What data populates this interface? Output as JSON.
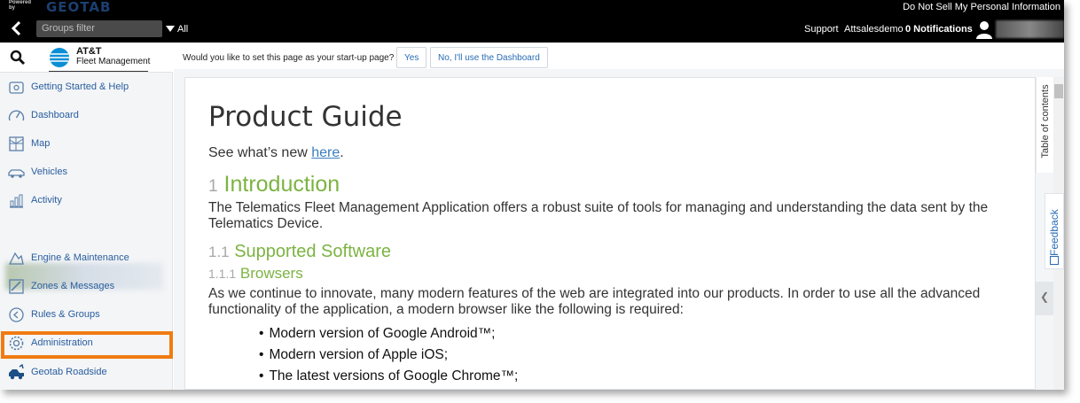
{
  "topbar": {
    "powered_by": "Powered by",
    "brand": "GEOTAB",
    "do_not_sell": "Do Not Sell My Personal Information"
  },
  "navbar": {
    "groups_placeholder": "Groups filter",
    "all_label": "All",
    "support": "Support",
    "user": "Attsalesdemo",
    "notifications": "0 Notifications"
  },
  "sidebar": {
    "logo_name": "AT&T",
    "logo_sub": "Fleet Management",
    "items": [
      {
        "label": "Getting Started & Help",
        "icon": "help-icon"
      },
      {
        "label": "Dashboard",
        "icon": "gauge-icon"
      },
      {
        "label": "Map",
        "icon": "map-icon"
      },
      {
        "label": "Vehicles",
        "icon": "vehicle-icon"
      },
      {
        "label": "Activity",
        "icon": "activity-icon"
      },
      {
        "label": "Engine & Maintenance",
        "icon": "engine-icon"
      },
      {
        "label": "Zones & Messages",
        "icon": "zones-icon"
      },
      {
        "label": "Rules & Groups",
        "icon": "rules-icon"
      },
      {
        "label": "Administration",
        "icon": "gear-icon"
      },
      {
        "label": "Geotab Roadside",
        "icon": "roadside-icon"
      }
    ],
    "highlighted_item": "Administration"
  },
  "startup": {
    "question": "Would you like to set this page as your start-up page?",
    "yes_label": "Yes",
    "no_label": "No, I'll use the Dashboard"
  },
  "doc": {
    "title": "Product Guide",
    "whats_new_prefix": "See what’s new ",
    "whats_new_link": "here",
    "whats_new_suffix": ".",
    "h1_num": "1",
    "h1_text": "Introduction",
    "p1": "The Telematics Fleet Management Application offers a robust suite of tools for managing and understanding the data sent by the Telematics Device.",
    "h2_num": "1.1",
    "h2_text": "Supported Software",
    "h3_num": "1.1.1",
    "h3_text": "Browsers",
    "p2": "As we continue to innovate, many modern features of the web are integrated into our products. In order to use all the advanced functionality of the application, a modern browser like the following is required:",
    "bullets": [
      "Modern version of Google Android™;",
      "Modern version of Apple iOS;",
      "The latest versions of Google Chrome™;"
    ]
  },
  "right": {
    "toc_label": "Table of contents",
    "feedback_label": "Feedback"
  },
  "colors": {
    "accent_green": "#7cb342",
    "link_blue": "#2a6cb5",
    "highlight_orange": "#f07b12"
  }
}
